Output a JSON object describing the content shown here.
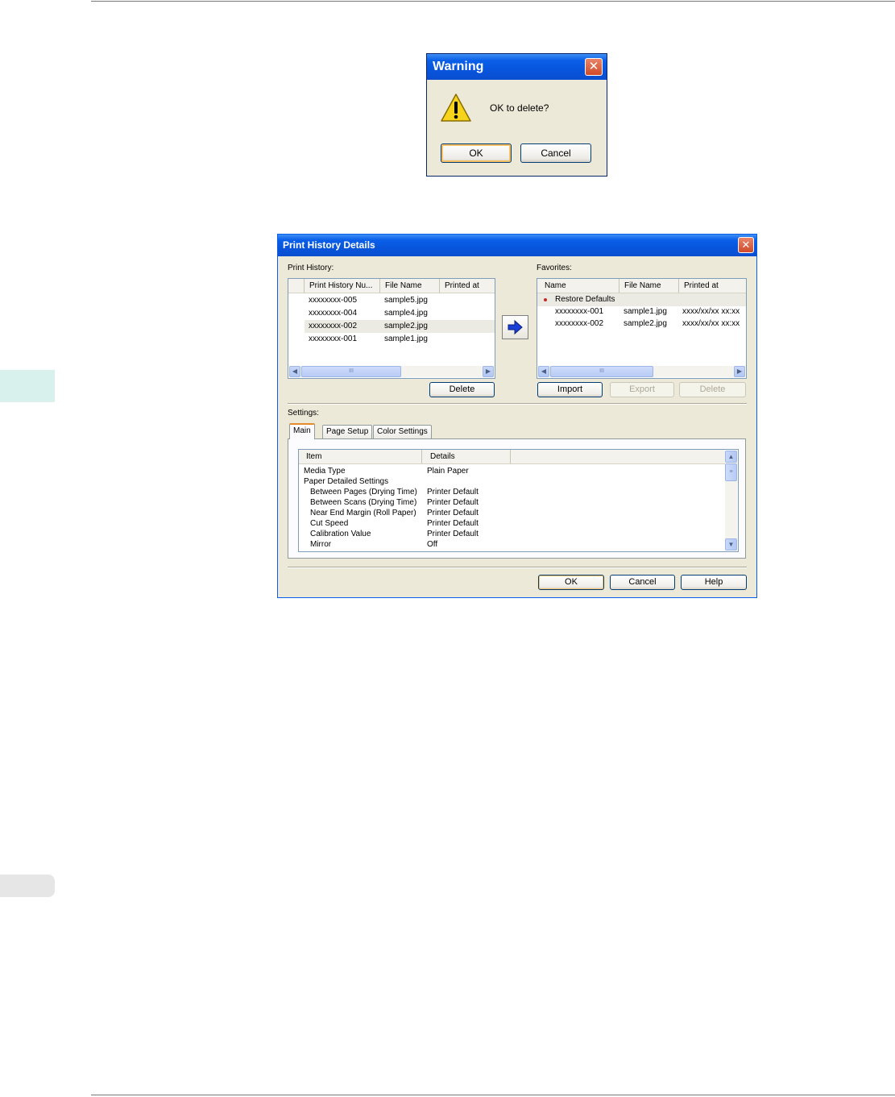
{
  "warning": {
    "title": "Warning",
    "message": "OK to delete?",
    "ok_label": "OK",
    "cancel_label": "Cancel"
  },
  "history_dialog": {
    "title": "Print History Details",
    "print_history": {
      "label": "Print History:",
      "columns": [
        "Print History Nu...",
        "File Name",
        "Printed at"
      ],
      "rows": [
        {
          "id": "xxxxxxxx-005",
          "file": "sample5.jpg",
          "printed": ""
        },
        {
          "id": "xxxxxxxx-004",
          "file": "sample4.jpg",
          "printed": ""
        },
        {
          "id": "xxxxxxxx-002",
          "file": "sample2.jpg",
          "printed": ""
        },
        {
          "id": "xxxxxxxx-001",
          "file": "sample1.jpg",
          "printed": ""
        }
      ],
      "selected_index": 2,
      "delete_label": "Delete"
    },
    "favorites": {
      "label": "Favorites:",
      "columns": [
        "Name",
        "File Name",
        "Printed at"
      ],
      "rows": [
        {
          "name": "Restore Defaults",
          "file": "",
          "printed": ""
        },
        {
          "name": "xxxxxxxx-001",
          "file": "sample1.jpg",
          "printed": "xxxx/xx/xx xx:xx"
        },
        {
          "name": "xxxxxxxx-002",
          "file": "sample2.jpg",
          "printed": "xxxx/xx/xx xx:xx"
        }
      ],
      "import_label": "Import",
      "export_label": "Export",
      "delete_label": "Delete"
    },
    "settings": {
      "label": "Settings:",
      "tabs": [
        "Main",
        "Page Setup",
        "Color Settings"
      ],
      "active_tab": "Main",
      "columns": [
        "Item",
        "Details"
      ],
      "rows": [
        {
          "item": "Media Type",
          "detail": "Plain Paper",
          "indent": 0
        },
        {
          "item": "Paper Detailed Settings",
          "detail": "",
          "indent": 0
        },
        {
          "item": "Between Pages (Drying Time)",
          "detail": "Printer Default",
          "indent": 1
        },
        {
          "item": "Between Scans (Drying Time)",
          "detail": "Printer Default",
          "indent": 1
        },
        {
          "item": "Near End Margin (Roll Paper)",
          "detail": "Printer Default",
          "indent": 1
        },
        {
          "item": "Cut Speed",
          "detail": "Printer Default",
          "indent": 1
        },
        {
          "item": "Calibration Value",
          "detail": "Printer Default",
          "indent": 1
        },
        {
          "item": "Mirror",
          "detail": "Off",
          "indent": 1
        }
      ]
    },
    "ok_label": "OK",
    "cancel_label": "Cancel",
    "help_label": "Help"
  },
  "colors": {
    "title_bar": "#0a5fe8",
    "dialog_bg": "#ece9d8",
    "side_tab": "#d9f1ec",
    "default_dot": "#c62828",
    "arrow_blue": "#1a3fd6"
  }
}
